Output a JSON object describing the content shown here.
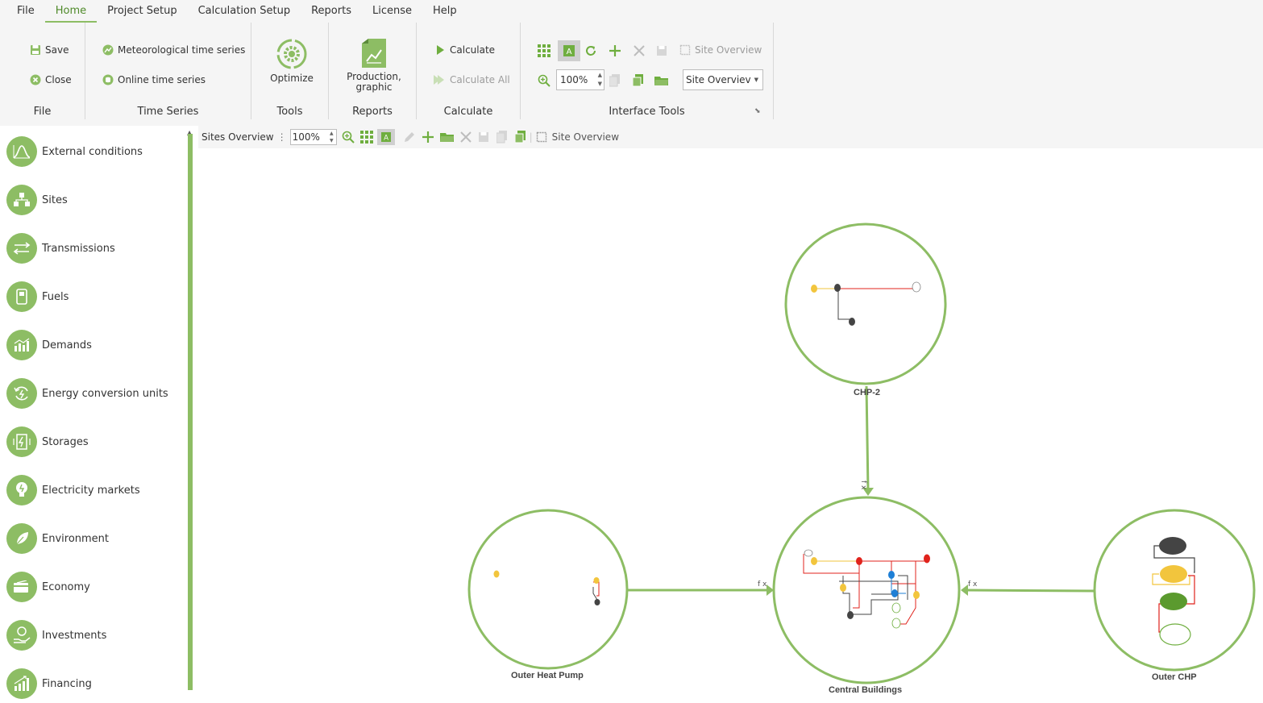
{
  "menu": [
    "File",
    "Home",
    "Project Setup",
    "Calculation Setup",
    "Reports",
    "License",
    "Help"
  ],
  "ribbon": {
    "file": {
      "title": "File",
      "save": "Save",
      "close": "Close"
    },
    "time_series": {
      "title": "Time Series",
      "meteo": "Meteorological time series",
      "online": "Online time series"
    },
    "tools": {
      "title": "Tools",
      "optimize": "Optimize"
    },
    "reports": {
      "title": "Reports",
      "production_l1": "Production,",
      "production_l2": "graphic"
    },
    "calculate": {
      "title": "Calculate",
      "calculate": "Calculate",
      "calculate_all": "Calculate All"
    },
    "interface": {
      "title": "Interface Tools",
      "site_overview": "Site Overview",
      "zoom": "100%",
      "view_select": "Site Overviev"
    }
  },
  "sidebar": {
    "items": [
      {
        "label": "External conditions",
        "icon": "bell-curve-icon"
      },
      {
        "label": "Sites",
        "icon": "sites-network-icon"
      },
      {
        "label": "Transmissions",
        "icon": "arrows-exchange-icon"
      },
      {
        "label": "Fuels",
        "icon": "fuel-pump-icon"
      },
      {
        "label": "Demands",
        "icon": "bar-chart-icon"
      },
      {
        "label": "Energy conversion units",
        "icon": "conversion-cycle-icon"
      },
      {
        "label": "Storages",
        "icon": "battery-icon"
      },
      {
        "label": "Electricity markets",
        "icon": "lightbulb-icon"
      },
      {
        "label": "Environment",
        "icon": "leaf-icon"
      },
      {
        "label": "Economy",
        "icon": "credit-card-icon"
      },
      {
        "label": "Investments",
        "icon": "hand-coin-icon"
      },
      {
        "label": "Financing",
        "icon": "growth-bars-icon"
      }
    ]
  },
  "canvas_toolbar": {
    "title": "Sites Overview",
    "zoom": "100%",
    "site_overview": "Site Overview"
  },
  "sites": {
    "chp2": "CHP-2",
    "heat_pump": "Outer Heat Pump",
    "central": "Central Buildings",
    "outer_chp": "Outer CHP"
  },
  "connector_label": "f x",
  "colors": {
    "accent": "#8dbd64",
    "accent_dark": "#4f8a2a",
    "yellow": "#f2c53d",
    "red": "#e0231c",
    "dark": "#444444",
    "blue": "#1e7fd6",
    "green": "#5b9a2e"
  }
}
